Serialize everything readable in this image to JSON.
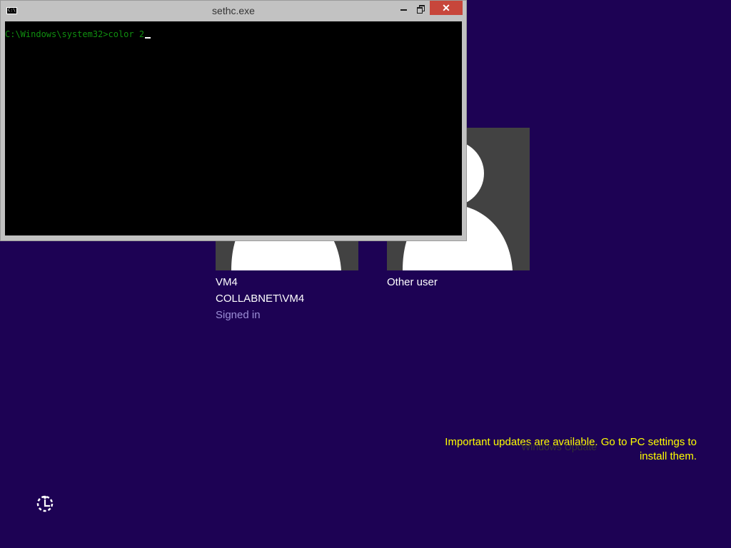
{
  "console": {
    "title": "sethc.exe",
    "icon_text": "C:\\",
    "prompt": "C:\\Windows\\system32>",
    "command": "color 2",
    "text_color": "#108f10",
    "close_glyph": "✕"
  },
  "users": [
    {
      "name": "VM4",
      "account": "COLLABNET\\VM4",
      "status": "Signed in"
    },
    {
      "name": "Other user"
    }
  ],
  "notification": {
    "title": "Windows Update",
    "message": "Important updates are available. Go to PC settings to install them."
  },
  "icons": {
    "ease_of_access": "ease-of-access-icon",
    "user": "user-silhouette-icon"
  },
  "colors": {
    "background": "#1d0254",
    "tile": "#424242",
    "notification_text": "#ffff00",
    "status_text": "#9c8fd6"
  }
}
